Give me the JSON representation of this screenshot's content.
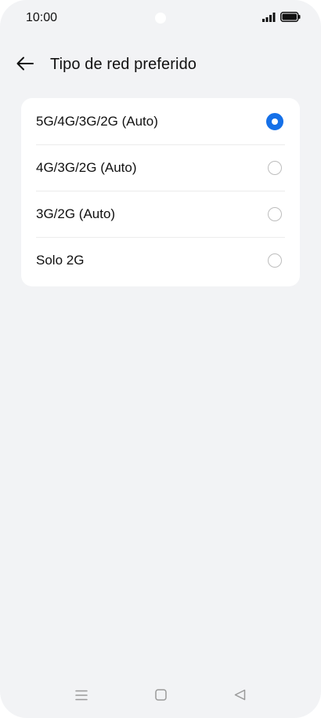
{
  "status_bar": {
    "time": "10:00",
    "icons": [
      "signal-icon",
      "battery-icon"
    ]
  },
  "header": {
    "title": "Tipo de red preferido",
    "back_icon": "arrow-left-icon"
  },
  "options": [
    {
      "label": "5G/4G/3G/2G (Auto)",
      "selected": true
    },
    {
      "label": "4G/3G/2G (Auto)",
      "selected": false
    },
    {
      "label": "3G/2G (Auto)",
      "selected": false
    },
    {
      "label": "Solo 2G",
      "selected": false
    }
  ],
  "nav_bar": {
    "icons": [
      "menu-icon",
      "home-icon",
      "back-triangle-icon"
    ]
  },
  "colors": {
    "background": "#f2f3f5",
    "card": "#ffffff",
    "accent": "#1570e8",
    "radio_border": "#bdbdbd"
  }
}
